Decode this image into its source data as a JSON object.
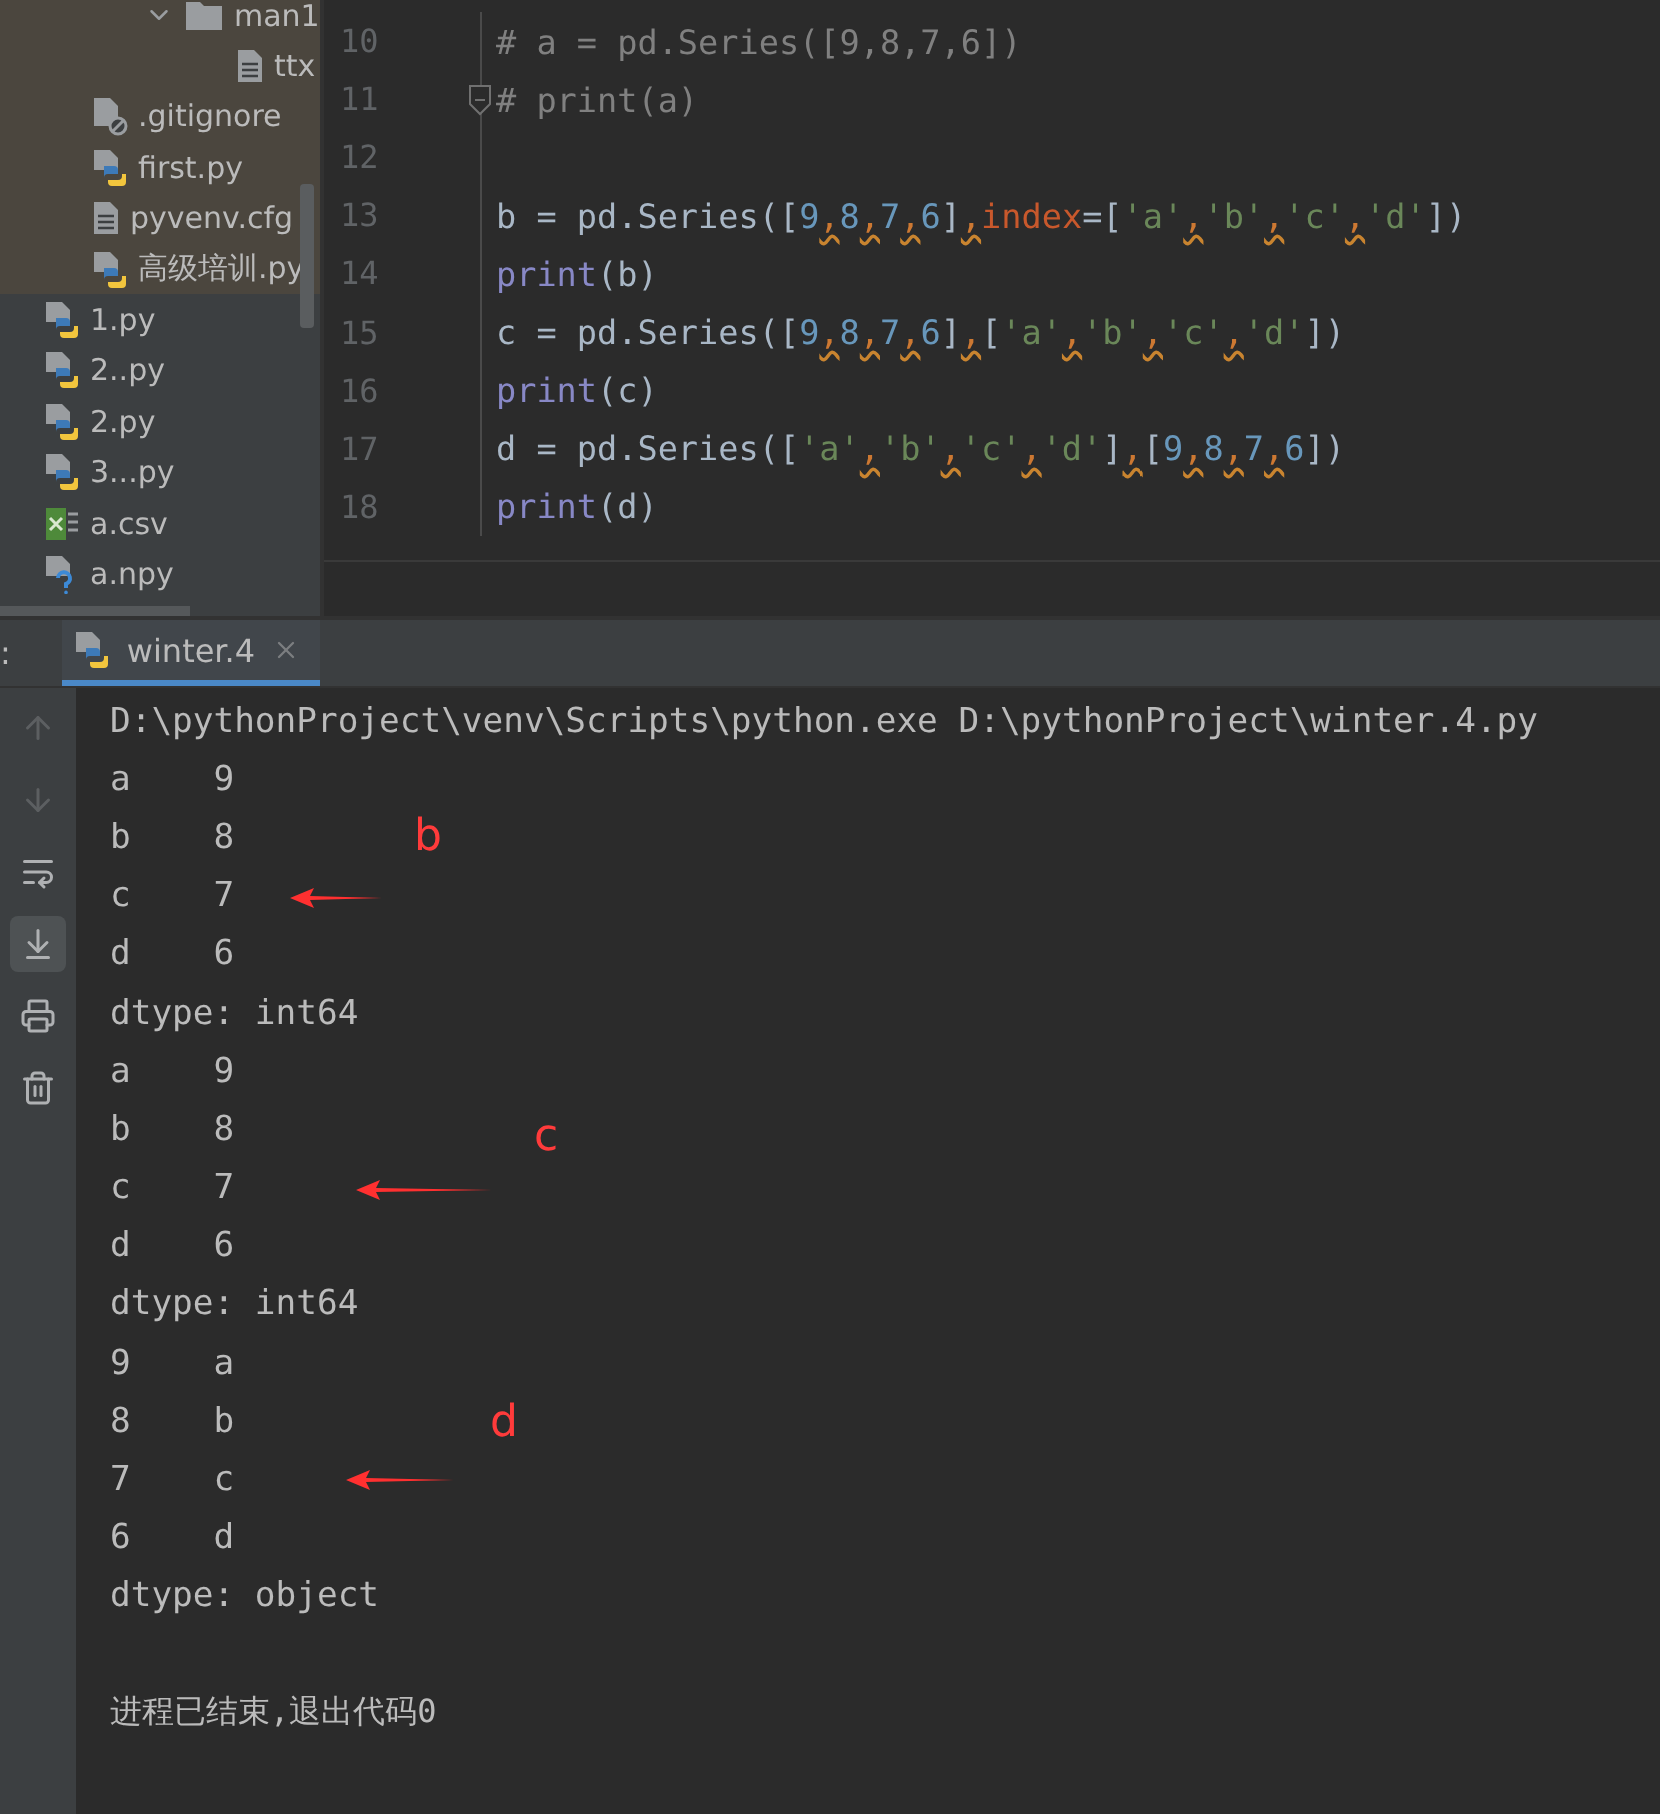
{
  "project_tree": [
    {
      "kind": "group",
      "selected": true,
      "children": [
        {
          "kind": "group",
          "children": [
            {
              "kind": "group",
              "children": [
                {
                  "kind": "folder",
                  "name": "man1",
                  "expanded": true,
                  "children": [
                    {
                      "kind": "text",
                      "name": "ttx"
                    }
                  ]
                }
              ]
            }
          ]
        },
        {
          "kind": "ignored",
          "name": ".gitignore"
        },
        {
          "kind": "python",
          "name": "first.py"
        },
        {
          "kind": "text",
          "name": "pyvenv.cfg"
        },
        {
          "kind": "python",
          "name": "高级培训.py"
        }
      ]
    },
    {
      "kind": "python",
      "name": "1.py"
    },
    {
      "kind": "python",
      "name": "2..py"
    },
    {
      "kind": "python",
      "name": "2.py"
    },
    {
      "kind": "python",
      "name": "3...py"
    },
    {
      "kind": "csv",
      "name": "a.csv"
    },
    {
      "kind": "unknown",
      "name": "a.npy"
    }
  ],
  "editor": {
    "lines": [
      {
        "number": "10",
        "tokens": [
          {
            "text": "# a = pd.Series([9,8,7,6])",
            "kind": "comment"
          }
        ]
      },
      {
        "number": "11",
        "fold": true,
        "tokens": [
          {
            "text": "# print(a)",
            "kind": "comment"
          }
        ]
      },
      {
        "number": "12"
      },
      {
        "number": "13",
        "tokens": [
          {
            "text": "b = pd.Series([",
            "kind": "plain"
          },
          {
            "text": "9",
            "kind": "number"
          },
          {
            "text": ",",
            "kind": "warn"
          },
          {
            "text": "8",
            "kind": "number"
          },
          {
            "text": ",",
            "kind": "warn"
          },
          {
            "text": "7",
            "kind": "number"
          },
          {
            "text": ",",
            "kind": "warn"
          },
          {
            "text": "6",
            "kind": "number"
          },
          {
            "text": "]",
            "kind": "plain"
          },
          {
            "text": ",",
            "kind": "warn"
          },
          {
            "text": "index",
            "kind": "param"
          },
          {
            "text": "=[",
            "kind": "plain"
          },
          {
            "text": "'a'",
            "kind": "string"
          },
          {
            "text": ",",
            "kind": "warn"
          },
          {
            "text": "'b'",
            "kind": "string"
          },
          {
            "text": ",",
            "kind": "warn"
          },
          {
            "text": "'c'",
            "kind": "string"
          },
          {
            "text": ",",
            "kind": "warn"
          },
          {
            "text": "'d'",
            "kind": "string"
          },
          {
            "text": "])",
            "kind": "plain"
          }
        ]
      },
      {
        "number": "14",
        "tokens": [
          {
            "text": "print",
            "kind": "builtin"
          },
          {
            "text": "(b)",
            "kind": "plain"
          }
        ]
      },
      {
        "number": "15",
        "tokens": [
          {
            "text": "c = pd.Series([",
            "kind": "plain"
          },
          {
            "text": "9",
            "kind": "number"
          },
          {
            "text": ",",
            "kind": "warn"
          },
          {
            "text": "8",
            "kind": "number"
          },
          {
            "text": ",",
            "kind": "warn"
          },
          {
            "text": "7",
            "kind": "number"
          },
          {
            "text": ",",
            "kind": "warn"
          },
          {
            "text": "6",
            "kind": "number"
          },
          {
            "text": "]",
            "kind": "plain"
          },
          {
            "text": ",",
            "kind": "warn"
          },
          {
            "text": "[",
            "kind": "plain"
          },
          {
            "text": "'a'",
            "kind": "string"
          },
          {
            "text": ",",
            "kind": "warn"
          },
          {
            "text": "'b'",
            "kind": "string"
          },
          {
            "text": ",",
            "kind": "warn"
          },
          {
            "text": "'c'",
            "kind": "string"
          },
          {
            "text": ",",
            "kind": "warn"
          },
          {
            "text": "'d'",
            "kind": "string"
          },
          {
            "text": "])",
            "kind": "plain"
          }
        ]
      },
      {
        "number": "16",
        "tokens": [
          {
            "text": "print",
            "kind": "builtin"
          },
          {
            "text": "(c)",
            "kind": "plain"
          }
        ]
      },
      {
        "number": "17",
        "tokens": [
          {
            "text": "d = pd.Series([",
            "kind": "plain"
          },
          {
            "text": "'a'",
            "kind": "string"
          },
          {
            "text": ",",
            "kind": "warn"
          },
          {
            "text": "'b'",
            "kind": "string"
          },
          {
            "text": ",",
            "kind": "warn"
          },
          {
            "text": "'c'",
            "kind": "string"
          },
          {
            "text": ",",
            "kind": "warn"
          },
          {
            "text": "'d'",
            "kind": "string"
          },
          {
            "text": "]",
            "kind": "plain"
          },
          {
            "text": ",",
            "kind": "warn"
          },
          {
            "text": "[",
            "kind": "plain"
          },
          {
            "text": "9",
            "kind": "number"
          },
          {
            "text": ",",
            "kind": "warn"
          },
          {
            "text": "8",
            "kind": "number"
          },
          {
            "text": ",",
            "kind": "warn"
          },
          {
            "text": "7",
            "kind": "number"
          },
          {
            "text": ",",
            "kind": "warn"
          },
          {
            "text": "6",
            "kind": "number"
          },
          {
            "text": "])",
            "kind": "plain"
          }
        ]
      },
      {
        "number": "18",
        "tokens": [
          {
            "text": "print",
            "kind": "builtin"
          },
          {
            "text": "(d)",
            "kind": "plain"
          }
        ]
      }
    ]
  },
  "run_panel": {
    "label": ":",
    "tabs": [
      {
        "title": "winter.4",
        "selected": true
      }
    ],
    "toolbar": [
      {
        "kind": "up",
        "disabled": true,
        "selected": false
      },
      {
        "kind": "down",
        "disabled": true,
        "selected": false
      },
      {
        "kind": "wrap",
        "disabled": false,
        "selected": false
      },
      {
        "kind": "scroll",
        "disabled": false,
        "selected": true
      },
      {
        "kind": "print",
        "disabled": false,
        "selected": false
      },
      {
        "kind": "trash",
        "disabled": false,
        "selected": false
      }
    ],
    "console": [
      {
        "text": "D:\\pythonProject\\venv\\Scripts\\python.exe D:\\pythonProject\\winter.4.py"
      },
      {
        "text": "a    9"
      },
      {
        "text": "b    8"
      },
      {
        "text": "c    7",
        "annotation": "b"
      },
      {
        "text": "d    6"
      },
      {
        "text": "dtype: int64"
      },
      {
        "text": "a    9"
      },
      {
        "text": "b    8"
      },
      {
        "text": "c    7",
        "annotation": "c"
      },
      {
        "text": "d    6"
      },
      {
        "text": "dtype: int64"
      },
      {
        "text": "9    a"
      },
      {
        "text": "8    b"
      },
      {
        "text": "7    c",
        "annotation": "d"
      },
      {
        "text": "6    d"
      },
      {
        "text": "dtype: object"
      },
      {
        "kind": "exit",
        "text": "进程已结束,退出代码0"
      }
    ]
  }
}
